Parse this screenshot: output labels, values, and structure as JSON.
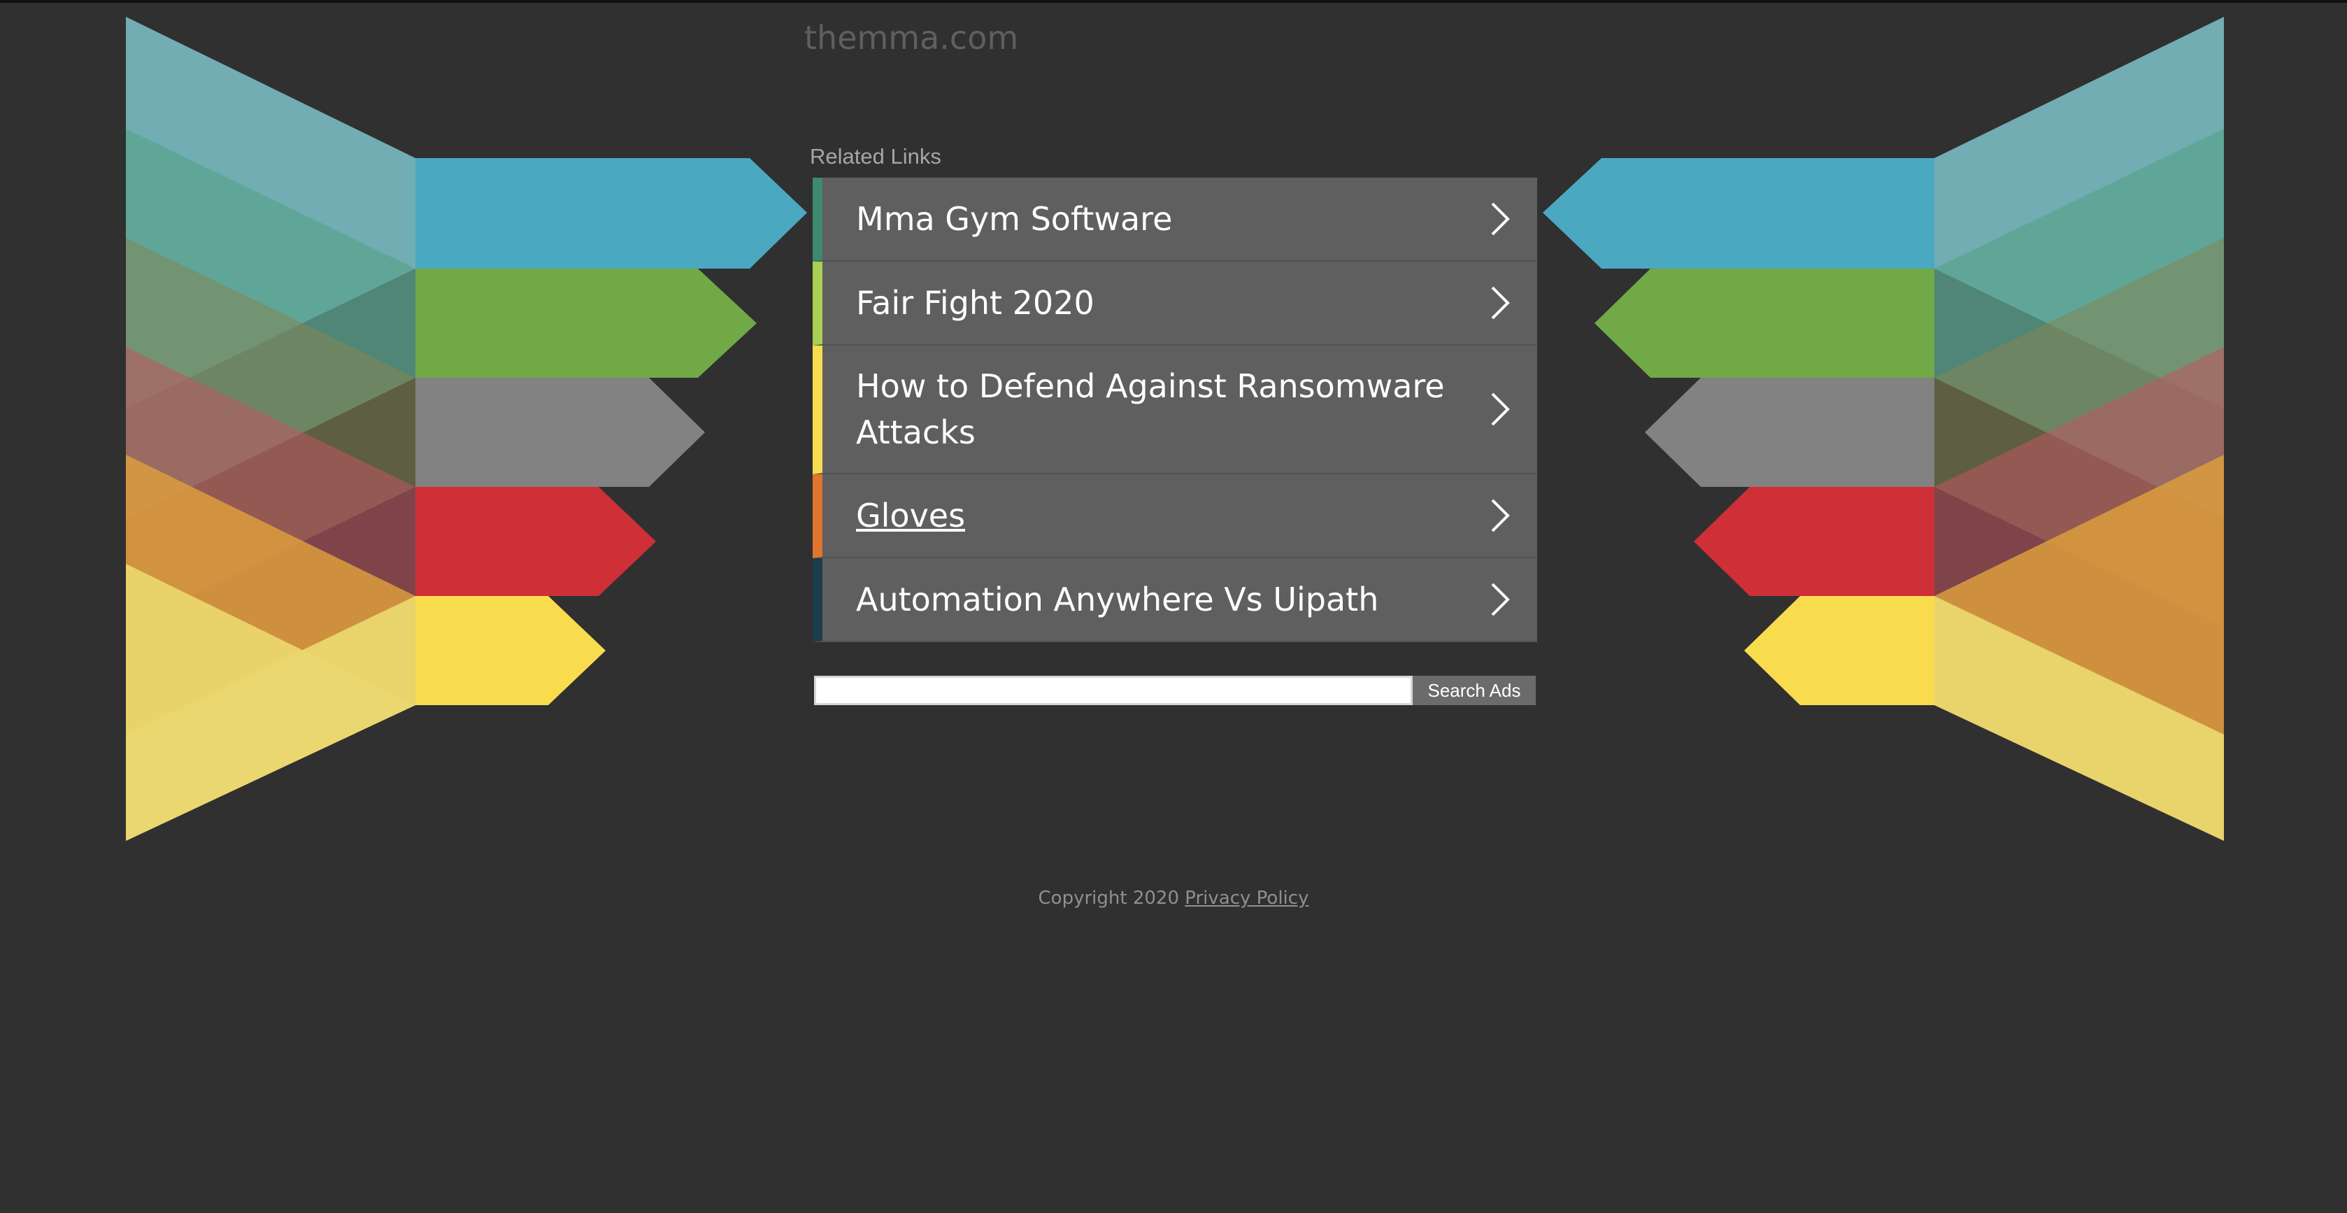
{
  "site": {
    "domain": "themma.com"
  },
  "related": {
    "label": "Related Links",
    "items": [
      {
        "label": "Mma Gym Software",
        "accent": "#3e8a6e",
        "underline": false
      },
      {
        "label": "Fair Fight 2020",
        "accent": "#a9cf55",
        "underline": false
      },
      {
        "label": "How to Defend Against Ransomware Attacks",
        "accent": "#f7dc4f",
        "underline": false
      },
      {
        "label": "Gloves",
        "accent": "#e0752e",
        "underline": true
      },
      {
        "label": "Automation Anywhere Vs Uipath",
        "accent": "#1b3d4d",
        "underline": false
      }
    ],
    "chevron_icon": "chevron-right-icon"
  },
  "search": {
    "value": "",
    "placeholder": "",
    "button_label": "Search Ads"
  },
  "footer": {
    "copyright": "Copyright 2020",
    "privacy_label": "Privacy Policy"
  },
  "colors": {
    "background": "#303030",
    "link_bg": "#5f5f5f",
    "ribbon_teal": "#4aa8c0",
    "ribbon_green": "#70a945",
    "ribbon_gray": "#808080",
    "ribbon_red": "#cf2f36",
    "ribbon_yellow": "#f8dc4e"
  }
}
